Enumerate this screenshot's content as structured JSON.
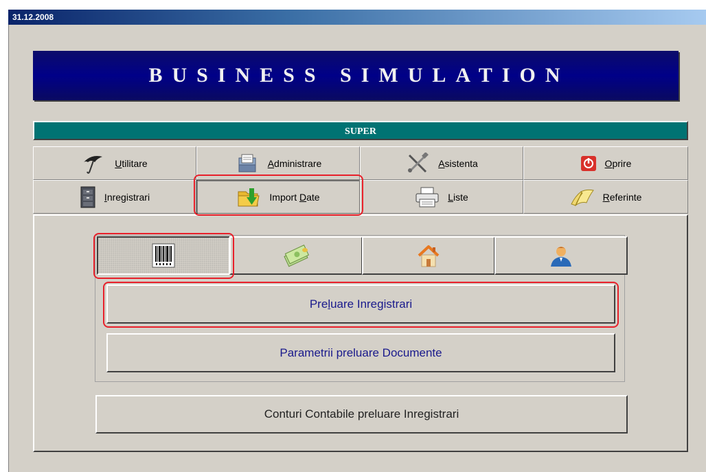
{
  "titlebar": {
    "date": "31.12.2008"
  },
  "banner": {
    "title": "BUSINESS SIMULATION"
  },
  "section": {
    "label": "SUPER"
  },
  "menu": {
    "utilitare": {
      "mnemonic": "U",
      "rest": "tilitare",
      "icon": "umbrella-icon"
    },
    "administrare": {
      "mnemonic": "A",
      "rest": "dministrare",
      "icon": "document-tray-icon"
    },
    "asistenta": {
      "mnemonic": "A",
      "rest": "sistenta",
      "icon": "tools-icon"
    },
    "oprire": {
      "mnemonic": "O",
      "rest": "prire",
      "icon": "power-icon"
    },
    "inregistrari": {
      "mnemonic": "I",
      "rest": "nregistrari",
      "icon": "file-cabinet-icon"
    },
    "import_date": {
      "before": "Import ",
      "mnemonic": "D",
      "rest": "ate",
      "icon": "folder-import-icon"
    },
    "liste": {
      "mnemonic": "L",
      "rest": "iste",
      "icon": "printer-icon"
    },
    "referinte": {
      "mnemonic": "R",
      "rest": "eferinte",
      "icon": "book-icon"
    }
  },
  "icon_tabs": [
    {
      "icon": "barcode-icon",
      "selected": true
    },
    {
      "icon": "money-icon",
      "selected": false
    },
    {
      "icon": "house-icon",
      "selected": false
    },
    {
      "icon": "user-icon",
      "selected": false
    }
  ],
  "actions": {
    "preluare_inregistrari": {
      "before": "Pre",
      "mnemonic": "l",
      "after": "uare Inregistrari"
    },
    "parametrii": "Parametrii preluare Documente",
    "conturi": "Conturi Contabile preluare Inregistrari"
  },
  "colors": {
    "highlight": "#e8202a",
    "section_bar": "#007373",
    "banner": "#000088",
    "action_text": "#1a1a8c"
  }
}
